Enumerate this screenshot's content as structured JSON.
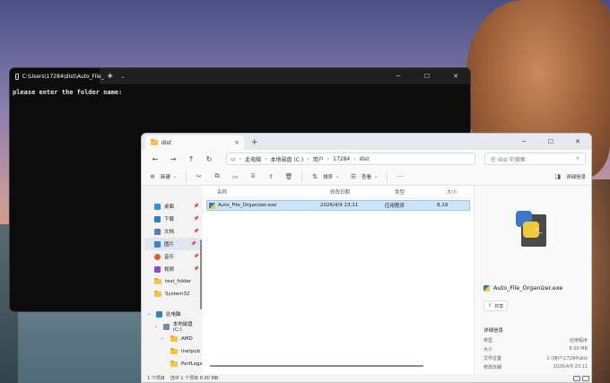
{
  "terminal": {
    "tab_title": "C:\\Users\\17284\\dist\\Auto_File_",
    "tab_close": "×",
    "new_tab": "+",
    "dropdown": "⌄",
    "minimize": "─",
    "maximize": "☐",
    "close": "✕",
    "output": "please enter the folder name:"
  },
  "explorer": {
    "tab_title": "dist",
    "tab_close": "×",
    "new_tab": "+",
    "minimize": "─",
    "maximize": "☐",
    "close": "✕",
    "nav": {
      "back": "←",
      "forward": "→",
      "up": "↑",
      "refresh": "↻",
      "monitor": "▭"
    },
    "breadcrumb": [
      "此电脑",
      "本地磁盘 (C:)",
      "用户",
      "17284",
      "dist"
    ],
    "breadcrumb_sep": "›",
    "search_placeholder": "在 dist 中搜索",
    "search_icon": "⌕",
    "toolbar": {
      "new_label": "新建",
      "sort_label": "排序",
      "view_label": "查看",
      "more": "···",
      "details_label": "详细信息"
    },
    "sidebar": {
      "items": [
        {
          "label": "桌面",
          "icon": "desktop-icon",
          "color": "#3a8fd8",
          "pinned": true
        },
        {
          "label": "下载",
          "icon": "download-icon",
          "color": "#2a7fc0",
          "pinned": true
        },
        {
          "label": "文档",
          "icon": "documents-icon",
          "color": "#5a7fb0",
          "pinned": true
        },
        {
          "label": "图片",
          "icon": "pictures-icon",
          "color": "#3a86c8",
          "pinned": true
        },
        {
          "label": "音乐",
          "icon": "music-icon",
          "color": "#e05a3a",
          "pinned": true
        },
        {
          "label": "视频",
          "icon": "videos-icon",
          "color": "#8a4ad0",
          "pinned": true
        },
        {
          "label": "test_folder",
          "icon": "folder-icon",
          "color": "#f6c34a",
          "pinned": false
        },
        {
          "label": "System32",
          "icon": "folder-icon",
          "color": "#f6c34a",
          "pinned": false
        }
      ],
      "tree": [
        {
          "label": "此电脑",
          "level": 1,
          "chevron": "⌄"
        },
        {
          "label": "本地磁盘 (C:)",
          "level": 2,
          "chevron": "⌄"
        },
        {
          "label": "AMD",
          "level": 3,
          "chevron": "›"
        },
        {
          "label": "inetpub",
          "level": 3,
          "chevron": ""
        },
        {
          "label": "PerfLogs",
          "level": 3,
          "chevron": ""
        }
      ]
    },
    "columns": [
      "名称",
      "修改日期",
      "类型",
      "大小"
    ],
    "files": [
      {
        "name": "Auto_File_Organizer.exe",
        "modified": "2026/4/9 23:11",
        "type": "应用程序",
        "size": "8,19"
      }
    ],
    "details": {
      "file_name": "Auto_File_Organizer.exe",
      "share_label": "共享",
      "section_title": "详细信息",
      "rows": [
        {
          "label": "类型",
          "value": "应用程序"
        },
        {
          "label": "大小",
          "value": "8.00 MB"
        },
        {
          "label": "文件位置",
          "value": "C:\\用户\\17284\\dist"
        },
        {
          "label": "修改日期",
          "value": "2026/4/9 23:11"
        }
      ]
    },
    "status": {
      "count": "1 个项目",
      "selected": "选中 1 个项目  8.00 MB"
    }
  }
}
